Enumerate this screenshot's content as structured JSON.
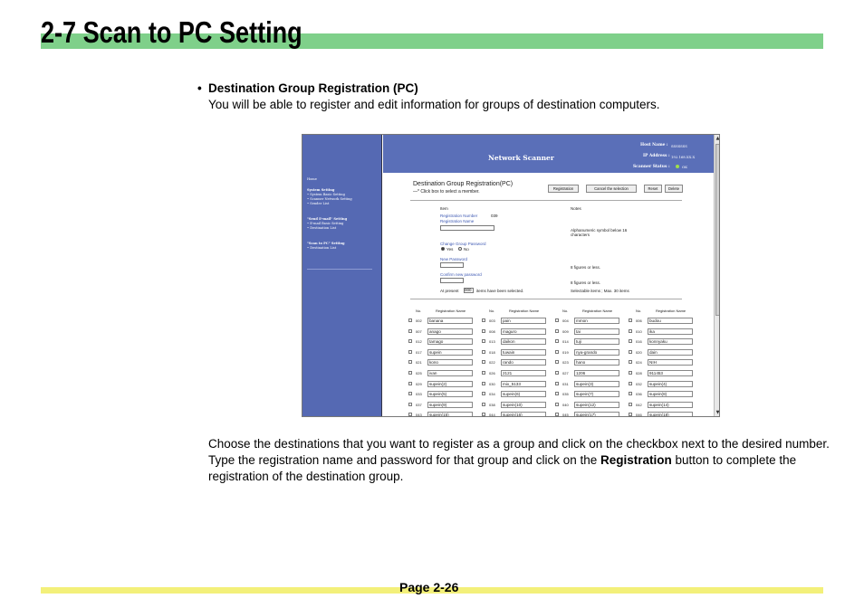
{
  "page": {
    "title": "2-7  Scan to PC Setting",
    "bullet_heading": "Destination Group Registration (PC)",
    "bullet_description": "You will be able to register and edit information for groups of destination computers.",
    "paragraph_part1": "Choose the destinations that you want to register as a group and click on the checkbox next to the desired number. Type the registration name and password for that group and click on the ",
    "paragraph_bold": "Registration",
    "paragraph_part2": " button to complete the registration of the destination group.",
    "page_number": "Page 2-26"
  },
  "screenshot": {
    "sidebar": [
      "Home",
      "System Setting",
      "• System Basic Setting",
      "• Scanner Network Setting",
      "• Sender List",
      "\"Send E-mail\" Setting",
      "• E-mail Basic Setting",
      "• Destination List",
      "\"Scan to PC\" Setting",
      "• Destination List"
    ],
    "header": {
      "app_name": "Network Scanner",
      "host_label": "Host Name :",
      "host_value": "SSSSSSS",
      "ip_label": "IP Address :",
      "ip_value": "192.168.XX.X",
      "status_label": "Scanner Status :",
      "status_value": "OK"
    },
    "form": {
      "title": "Destination Group Registration(PC)",
      "subtitle": "—* Click box to select a member.",
      "buttons": [
        "Registration",
        "Cancel the selection",
        "Reset",
        "Delete"
      ],
      "col_item": "Item",
      "col_notes": "Notes",
      "reg_number_label": "Registration Number",
      "reg_number_value": "039",
      "reg_name_label": "Registration Name",
      "change_pw_label": "Change Group Password",
      "radio_yes": "Yes",
      "radio_no": "No",
      "new_pw_label": "New Password",
      "confirm_pw_label": "Confirm new password",
      "at_present_label": "At present",
      "at_present_value": "000",
      "at_present_suffix": "items have been selected.",
      "note_name": "Alphanumeric symbol below 16 characters",
      "note_pw1": "8 figures or less.",
      "note_pw2": "8 figures or less.",
      "note_selectable": "Selectable items ; Max. 30 items"
    },
    "grid": {
      "col_no": "No.",
      "col_name": "Registration Name",
      "rows": [
        [
          [
            "002",
            "banana"
          ],
          [
            "003",
            "pain"
          ],
          [
            "004",
            "mmon"
          ],
          [
            "006",
            "budou"
          ]
        ],
        [
          [
            "007",
            "anago"
          ],
          [
            "008",
            "maguro"
          ],
          [
            "009",
            "tai"
          ],
          [
            "010",
            "ika"
          ]
        ],
        [
          [
            "012",
            "tamago"
          ],
          [
            "013",
            "daikon"
          ],
          [
            "014",
            "tuji"
          ],
          [
            "016",
            "konnyaku"
          ]
        ],
        [
          [
            "017",
            "supein"
          ],
          [
            "018",
            "tuwain"
          ],
          [
            "019",
            "nya-grando"
          ],
          [
            "020",
            "dain"
          ]
        ],
        [
          [
            "021",
            "kono"
          ],
          [
            "022",
            "rando"
          ],
          [
            "023",
            "hano"
          ],
          [
            "024",
            "NIH"
          ]
        ],
        [
          [
            "025",
            "ivan"
          ],
          [
            "026",
            "2121"
          ],
          [
            "027",
            "1206"
          ],
          [
            "028",
            "911453"
          ]
        ],
        [
          [
            "029",
            "supein(2)"
          ],
          [
            "030",
            "mix_5133"
          ],
          [
            "031",
            "supein(3)"
          ],
          [
            "032",
            "supein(4)"
          ]
        ],
        [
          [
            "033",
            "supein(5)"
          ],
          [
            "034",
            "supein(6)"
          ],
          [
            "035",
            "supein(7)"
          ],
          [
            "036",
            "supein(8)"
          ]
        ],
        [
          [
            "037",
            "supein(9)"
          ],
          [
            "038",
            "supein(10)"
          ],
          [
            "040",
            "supein(12)"
          ],
          [
            "042",
            "supein(14)"
          ]
        ],
        [
          [
            "043",
            "supein(15)"
          ],
          [
            "044",
            "supein(16)"
          ],
          [
            "045",
            "supein(17)"
          ],
          [
            "046",
            "supein(18)"
          ]
        ]
      ]
    }
  }
}
